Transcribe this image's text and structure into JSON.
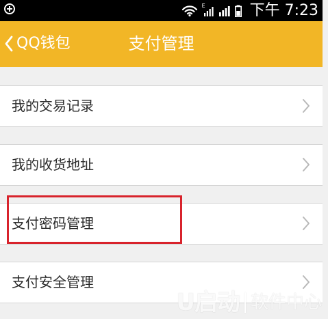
{
  "status_bar": {
    "network_label": "E",
    "time": "下午 7:23"
  },
  "header": {
    "back_label": "QQ钱包",
    "title": "支付管理"
  },
  "menu": {
    "items": [
      {
        "label": "我的交易记录"
      },
      {
        "label": "我的收货地址"
      },
      {
        "label": "支付密码管理"
      },
      {
        "label": "支付安全管理"
      }
    ]
  },
  "watermark": {
    "logo": "U启动",
    "subtitle": "软件中心"
  },
  "colors": {
    "status_bar": "#000000",
    "header": "#f2b626",
    "background": "#f0f0f0",
    "item_background": "#ffffff",
    "highlight": "#d8232c",
    "chevron": "#b8b8b8"
  },
  "icons": {
    "status_left": "plus-circle-icon",
    "wifi": "wifi-icon",
    "network": "network-icon",
    "signal": "signal-icon",
    "battery": "battery-icon",
    "back": "chevron-left-icon",
    "list_chevron": "chevron-right-icon"
  }
}
